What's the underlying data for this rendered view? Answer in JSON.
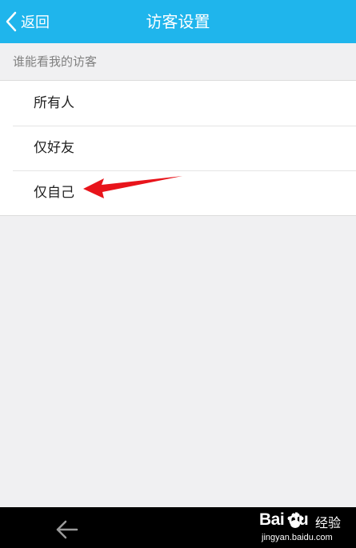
{
  "header": {
    "back_label": "返回",
    "title": "访客设置"
  },
  "section": {
    "label": "谁能看我的访客"
  },
  "options": [
    {
      "label": "所有人"
    },
    {
      "label": "仅好友"
    },
    {
      "label": "仅自己"
    }
  ],
  "annotation": {
    "color": "#e8141b"
  },
  "watermark": {
    "brand": "Bai du",
    "product": "经验",
    "url": "jingyan.baidu.com"
  },
  "colors": {
    "header": "#1fb5ec",
    "background": "#f0f0f2"
  }
}
